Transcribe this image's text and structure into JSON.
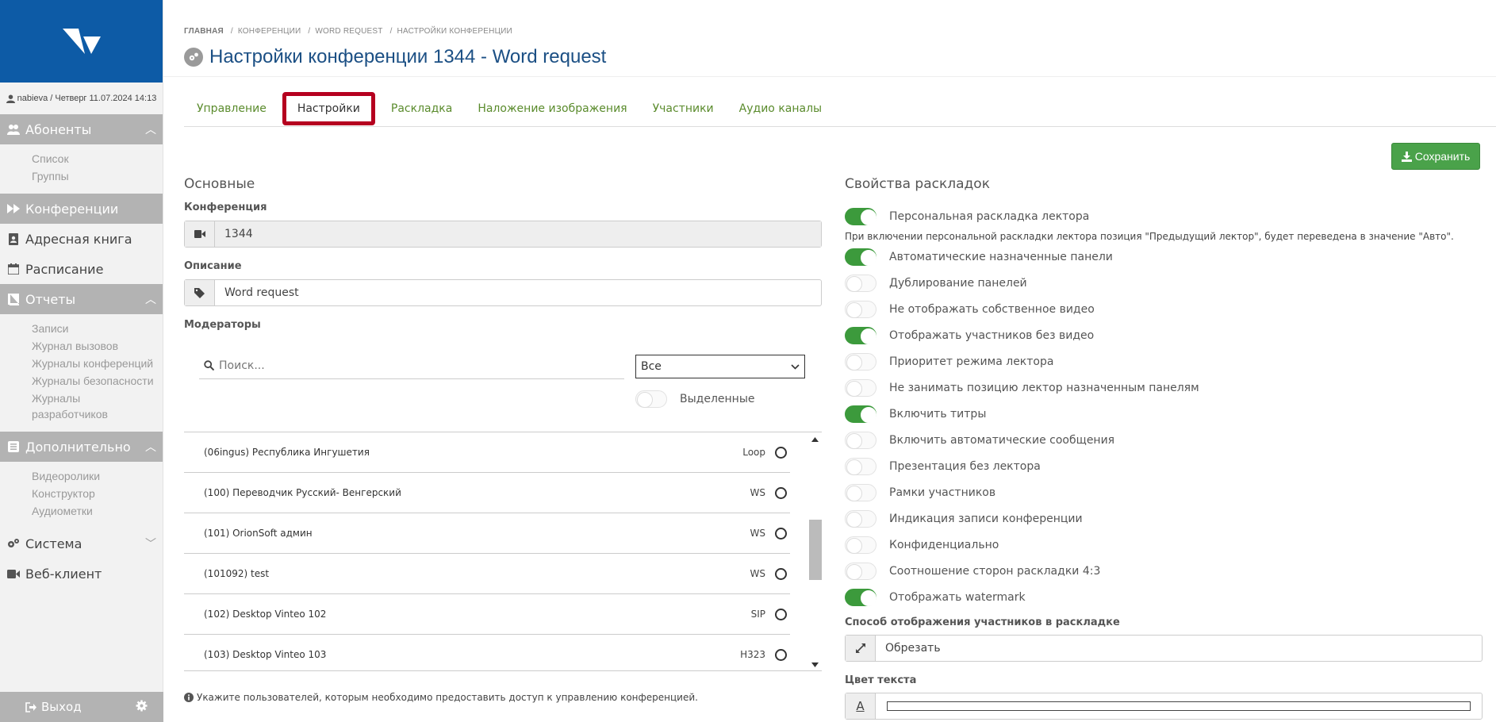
{
  "sidebar": {
    "user_info": "nabieva / Четверг 11.07.2024 14:13",
    "sections": [
      {
        "label": "Абоненты",
        "items": [
          "Список",
          "Группы"
        ]
      },
      {
        "label": "Конференции"
      },
      {
        "label": "Адресная книга"
      },
      {
        "label": "Расписание"
      },
      {
        "label": "Отчеты",
        "items": [
          "Записи",
          "Журнал вызовов",
          "Журналы конференций",
          "Журналы безопасности",
          "Журналы разработчиков"
        ]
      },
      {
        "label": "Дополнительно",
        "items": [
          "Видеоролики",
          "Конструктор",
          "Аудиометки"
        ]
      },
      {
        "label": "Система"
      },
      {
        "label": "Веб-клиент"
      }
    ],
    "logout_label": "Выход"
  },
  "breadcrumb": [
    "ГЛАВНАЯ",
    "КОНФЕРЕНЦИИ",
    "WORD REQUEST",
    "НАСТРОЙКИ КОНФЕРЕНЦИИ"
  ],
  "page_title": "Настройки конференции 1344 - Word request",
  "tabs": [
    "Управление",
    "Настройки",
    "Раскладка",
    "Наложение изображения",
    "Участники",
    "Аудио каналы"
  ],
  "save_label": "Сохранить",
  "basic": {
    "heading": "Основные",
    "conference_label": "Конференция",
    "conference_value": "1344",
    "description_label": "Описание",
    "description_value": "Word request",
    "moderators_label": "Модераторы",
    "search_placeholder": "Поиск...",
    "filter_value": "Все",
    "selected_label": "Выделенные",
    "moderators": [
      {
        "name": "(06ingus) Республика Ингушетия",
        "proto": "Loop"
      },
      {
        "name": "(100) Переводчик Русский- Венгерский",
        "proto": "WS"
      },
      {
        "name": "(101) OrionSoft админ",
        "proto": "WS"
      },
      {
        "name": "(101092) test",
        "proto": "WS"
      },
      {
        "name": "(102) Desktop Vinteo 102",
        "proto": "SIP"
      },
      {
        "name": "(103) Desktop Vinteo 103",
        "proto": "H323"
      }
    ],
    "note": "Укажите пользователей, которым необходимо предоставить доступ к управлению конференцией."
  },
  "layout_props": {
    "heading": "Свойства раскладок",
    "hint": "При включении персональной раскладки лектора позиция \"Предыдущий лектор\", будет переведена в значение \"Авто\".",
    "toggles": [
      {
        "label": "Персональная раскладка лектора",
        "on": true
      },
      {
        "label": "Автоматические назначенные панели",
        "on": true
      },
      {
        "label": "Дублирование панелей",
        "on": false
      },
      {
        "label": "Не отображать собственное видео",
        "on": false
      },
      {
        "label": "Отображать участников без видео",
        "on": true
      },
      {
        "label": "Приоритет режима лектора",
        "on": false
      },
      {
        "label": "Не занимать позицию лектор назначенным панелям",
        "on": false
      },
      {
        "label": "Включить титры",
        "on": true
      },
      {
        "label": "Включить автоматические сообщения",
        "on": false
      },
      {
        "label": "Презентация без лектора",
        "on": false
      },
      {
        "label": "Рамки участников",
        "on": false
      },
      {
        "label": "Индикация записи конференции",
        "on": false
      },
      {
        "label": "Конфиденциально",
        "on": false
      },
      {
        "label": "Соотношение сторон раскладки 4:3",
        "on": false
      },
      {
        "label": "Отображать watermark",
        "on": true
      }
    ],
    "display_mode_label": "Способ отображения участников в раскладке",
    "display_mode_value": "Обрезать",
    "text_color_label": "Цвет текста",
    "text_color_icon": "A"
  },
  "colors": {
    "brand": "#0d5ba6",
    "accent_green": "#4aa24a",
    "tab_highlight": "#b5001f",
    "title": "#1b4f84"
  }
}
